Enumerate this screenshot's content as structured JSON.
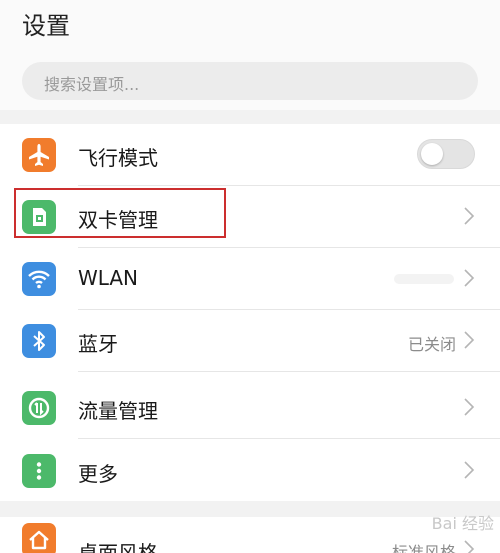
{
  "header": {
    "title": "设置"
  },
  "search": {
    "placeholder": "搜索设置项..."
  },
  "items": [
    {
      "label": "飞行模式",
      "icon": "airplane-icon",
      "color": "#f17c2c",
      "toggle": "off"
    },
    {
      "label": "双卡管理",
      "icon": "sim-card-icon",
      "color": "#4cb96a"
    },
    {
      "label": "WLAN",
      "icon": "wifi-icon",
      "color": "#3e8ee0"
    },
    {
      "label": "蓝牙",
      "icon": "bluetooth-icon",
      "color": "#3e8ee0",
      "value": "已关闭"
    },
    {
      "label": "流量管理",
      "icon": "data-usage-icon",
      "color": "#4cb96a"
    },
    {
      "label": "更多",
      "icon": "more-icon",
      "color": "#4cb96a"
    }
  ],
  "items2": [
    {
      "label": "桌面风格",
      "icon": "home-icon",
      "color": "#f17c2c",
      "value": "标准风格"
    }
  ],
  "watermark": "Bai 经验"
}
